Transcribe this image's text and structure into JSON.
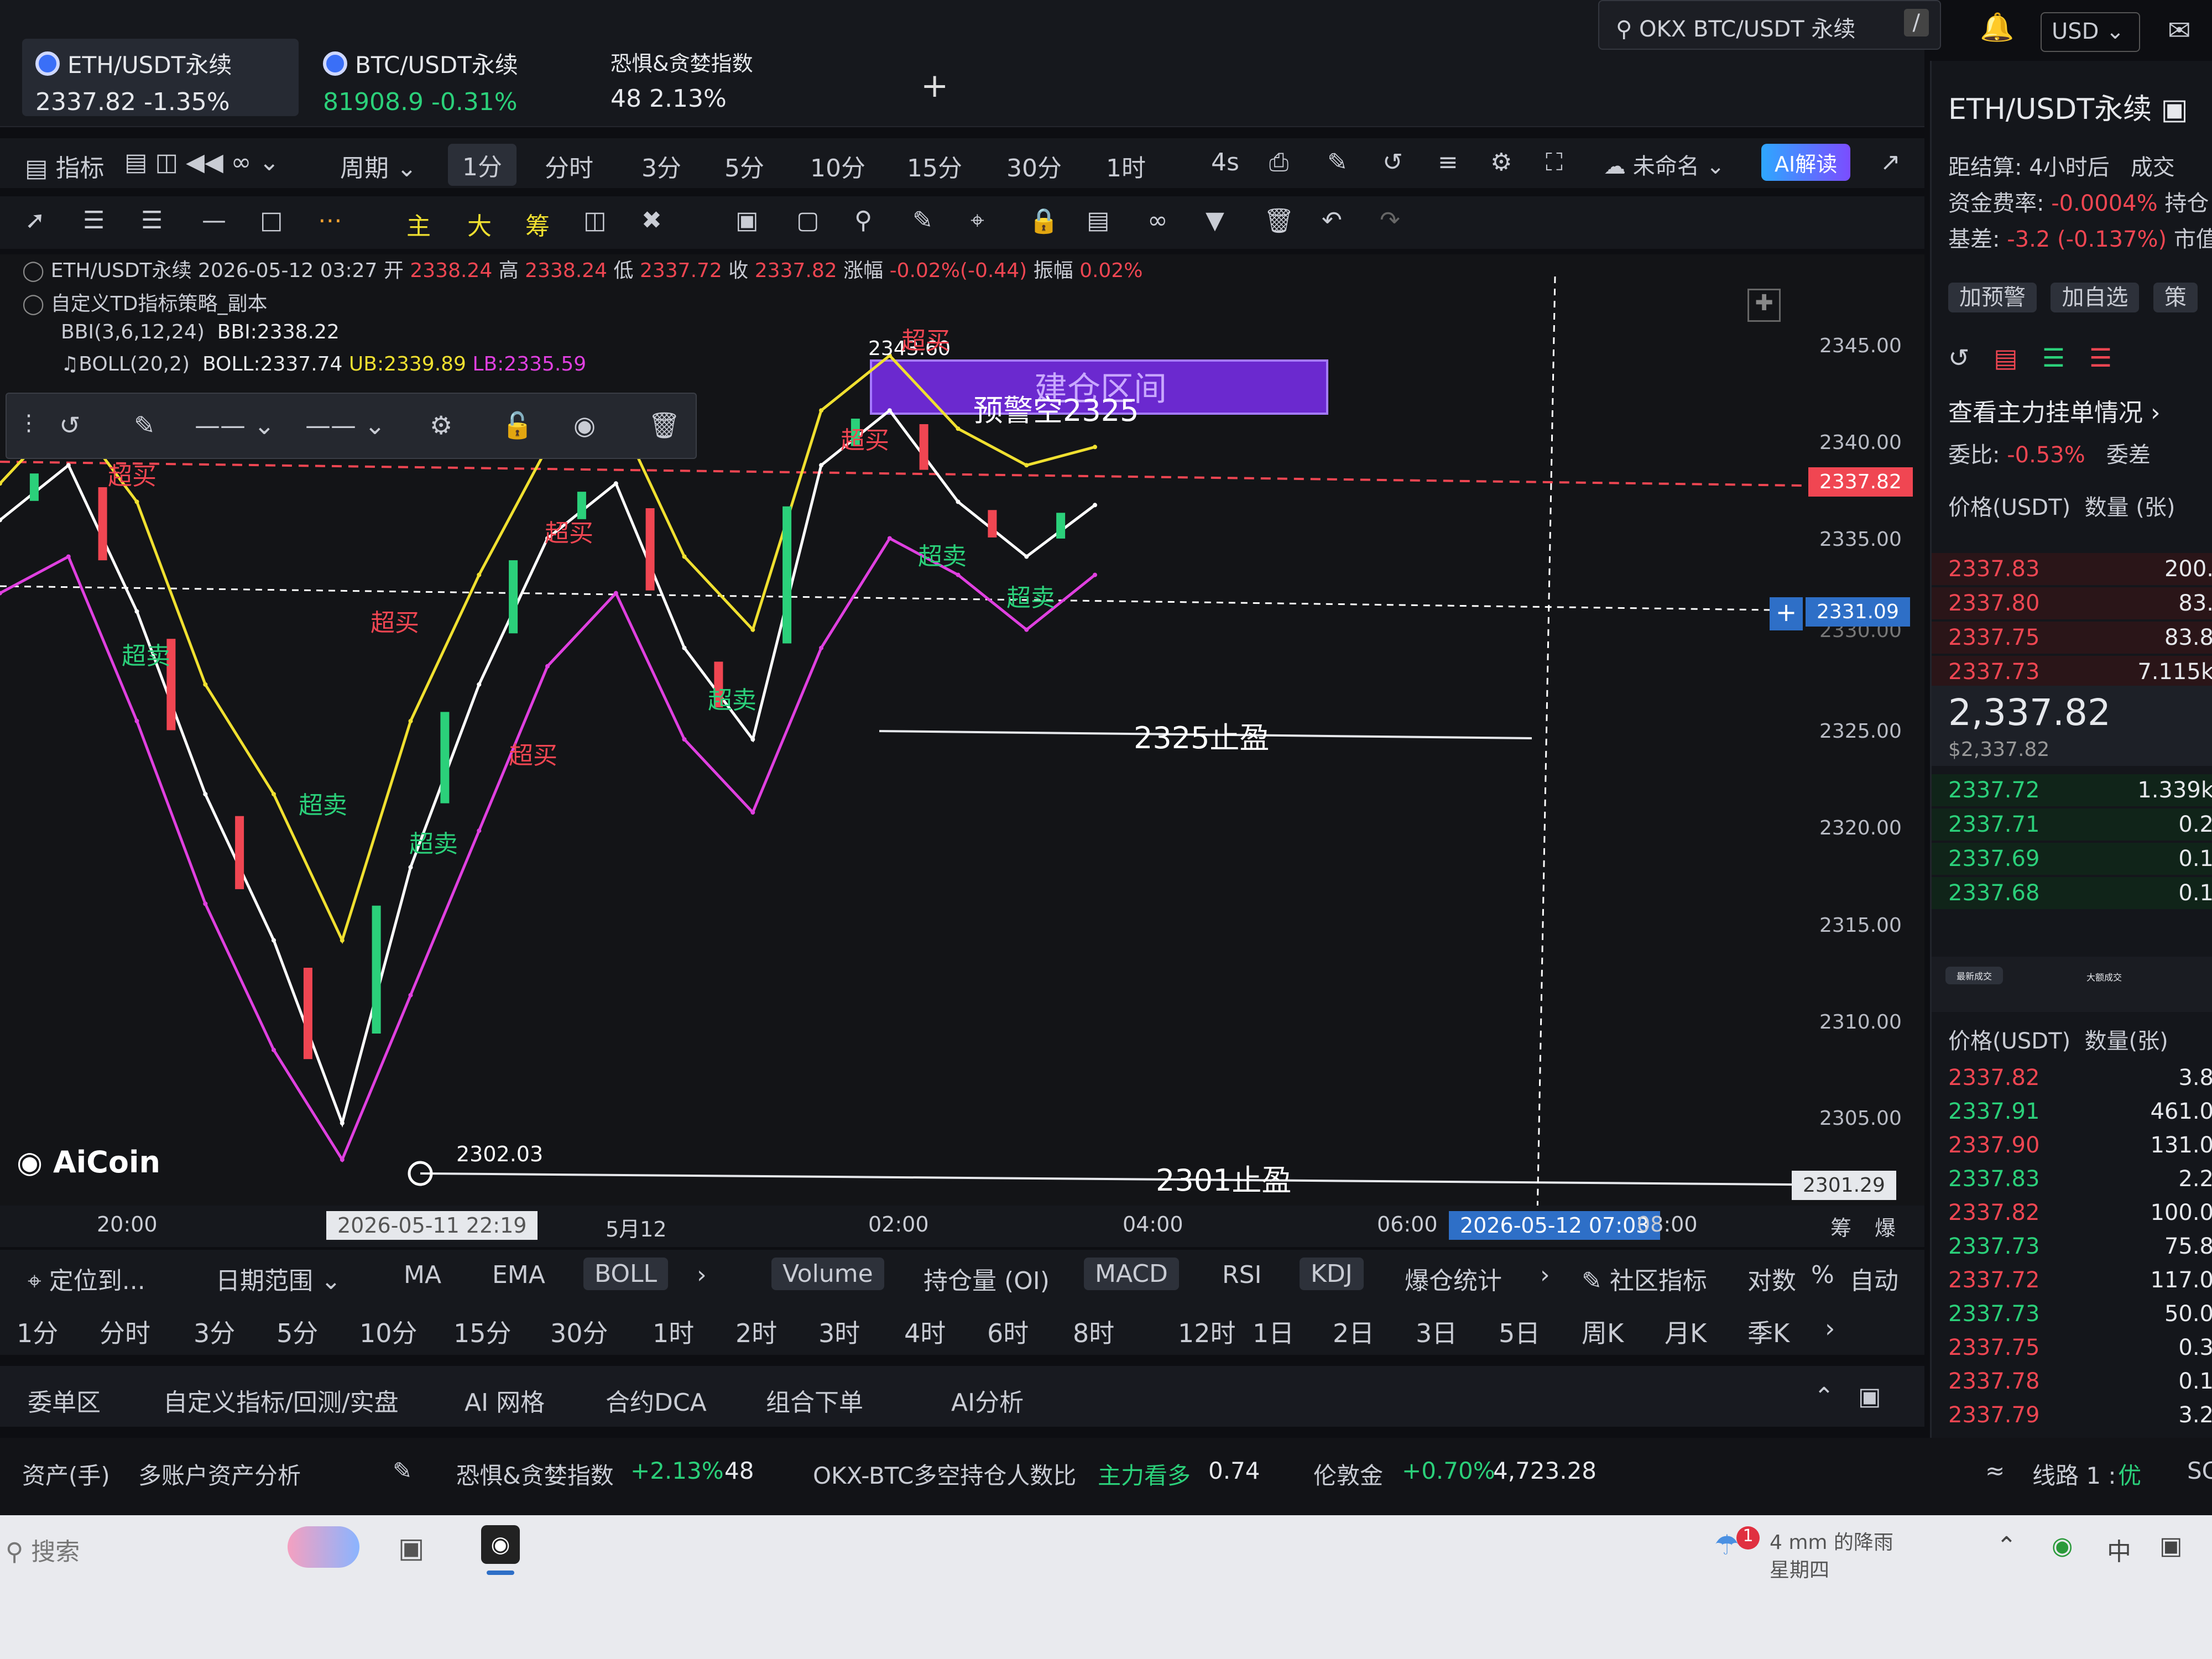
{
  "top_search": {
    "text": "OKX BTC/USDT 永续",
    "slash": "/",
    "currency": "USD"
  },
  "tabs": [
    {
      "name": "ETH/USDT永续",
      "price": "2337.82",
      "change": "-1.35%"
    },
    {
      "name": "BTC/USDT永续",
      "price": "81908.9",
      "change": "-0.31%"
    },
    {
      "name": "恐惧&贪婪指数",
      "price": "48",
      "change": "2.13%"
    }
  ],
  "add_tab": "+",
  "toolbar1": {
    "indicator": "指标",
    "period": "周期",
    "intervals": [
      "1分",
      "分时",
      "3分",
      "5分",
      "10分",
      "15分",
      "30分",
      "1时",
      "4s"
    ],
    "active_interval": "1分",
    "unnamed": "未命名",
    "ai": "AI解读"
  },
  "toolbar2": {
    "labels": [
      "主",
      "大",
      "筹"
    ]
  },
  "chart_info": {
    "symbol_line": "ETH/USDT永续 2026-05-12 03:27",
    "open_label": "开",
    "open": "2338.24",
    "high_label": "高",
    "high": "2338.24",
    "low_label": "低",
    "low": "2337.72",
    "close_label": "收",
    "close": "2337.82",
    "chg_label": "涨幅",
    "chg": "-0.02%(-0.44)",
    "amp_label": "振幅",
    "amp": "0.02%",
    "strategy": "自定义TD指标策略_副本",
    "bbi_name": "BBI(3,6,12,24)",
    "bbi": "BBI:2338.22",
    "boll_name": "BOLL(20,2)",
    "boll": "BOLL:2337.74",
    "ub": "UB:2339.89",
    "lb": "LB:2335.59"
  },
  "annotations": {
    "box_text": "建仓区间",
    "short_text": "预警空2325",
    "high_marker": "2343.60",
    "tp1": "2325止盈",
    "tp2": "2301止盈",
    "low_marker": "2302.03",
    "overbought": "超买",
    "oversold": "超卖"
  },
  "chart_data": {
    "type": "line",
    "title": "ETH/USDT永续",
    "x": [
      "20:00",
      "5月12",
      "02:00",
      "04:00",
      "06:00",
      "08:00"
    ],
    "yticks": [
      "2345.00",
      "2340.00",
      "2335.00",
      "2330.00",
      "2325.00",
      "2320.00",
      "2315.00",
      "2310.00",
      "2305.00"
    ],
    "ylim": [
      2301,
      2347
    ],
    "series": [
      {
        "values": [
          2337,
          2340,
          2332,
          2322,
          2314,
          2304,
          2318,
          2328,
          2336,
          2339,
          2330,
          2325,
          2340,
          2343,
          2338,
          2335,
          2337.82
        ],
        "color": "#ffffff"
      },
      {
        "values": [
          2339,
          2343,
          2338,
          2328,
          2322,
          2314,
          2326,
          2334,
          2341,
          2343,
          2335,
          2331,
          2343,
          2346,
          2342,
          2340,
          2341
        ],
        "color": "#f0e030"
      },
      {
        "values": [
          2333,
          2335,
          2326,
          2316,
          2308,
          2302,
          2311,
          2320,
          2329,
          2333,
          2325,
          2321,
          2330,
          2336,
          2334,
          2331,
          2334
        ],
        "color": "#e040e0"
      }
    ],
    "last_price": "2337.82",
    "cursor_price": "2331.09",
    "bottom_price": "2301.29",
    "cursor_time": "2026-05-12 07:03",
    "start_time": "2026-05-11 22:19"
  },
  "watermark": "AiCoin",
  "chart_bottom_right": [
    "筹",
    "爆"
  ],
  "bottom_toolbar": {
    "locate": "定位到...",
    "date_range": "日期范围",
    "indicators": [
      "MA",
      "EMA",
      "BOLL"
    ],
    "sub_indicators": [
      "Volume",
      "持仓量 (OI)",
      "MACD",
      "RSI",
      "KDJ",
      "爆仓统计"
    ],
    "community": "社区指标",
    "log": "对数",
    "pct": "%",
    "auto": "自动",
    "periods": [
      "1分",
      "分时",
      "3分",
      "5分",
      "10分",
      "15分",
      "30分",
      "1时",
      "2时",
      "3时",
      "4时",
      "6时",
      "8时",
      "12时",
      "1日",
      "2日",
      "3日",
      "5日",
      "周K",
      "月K",
      "季K"
    ],
    "panels": [
      "委单区",
      "自定义指标/回测/实盘",
      "AI 网格",
      "合约DCA",
      "组合下单",
      "AI分析"
    ]
  },
  "right": {
    "title": "ETH/USDT永续",
    "settle_label": "距结算:",
    "settle": "4小时后",
    "vol_label": "成交",
    "funding_label": "资金费率:",
    "funding": "-0.0004%",
    "hold_label": "持仓",
    "basis_label": "基差:",
    "basis": "-3.2 (-0.137%)",
    "market_label": "市值",
    "btns": [
      "加预警",
      "加自选",
      "策"
    ],
    "mainforce": "查看主力挂单情况",
    "ratio_label": "委比:",
    "ratio": "-0.53%",
    "diff_label": "委差",
    "hdr_price": "价格(USDT)",
    "hdr_qty": "数量 (张)",
    "asks": [
      [
        "2337.83",
        "200."
      ],
      [
        "2337.80",
        "83."
      ],
      [
        "2337.75",
        "83.8"
      ],
      [
        "2337.73",
        "7.115k"
      ]
    ],
    "mid_price": "2,337.82",
    "mid_usd": "$2,337.82",
    "bids": [
      [
        "2337.72",
        "1.339k"
      ],
      [
        "2337.71",
        "0.2"
      ],
      [
        "2337.69",
        "0.1"
      ],
      [
        "2337.68",
        "0.1"
      ]
    ],
    "trade_tabs": [
      "最新成交",
      "大额成交"
    ],
    "trade_hdr_price": "价格(USDT)",
    "trade_hdr_qty": "数量(张)",
    "trades": [
      [
        "2337.82",
        "3.8",
        "red"
      ],
      [
        "2337.91",
        "461.0",
        "green"
      ],
      [
        "2337.90",
        "131.0",
        "red"
      ],
      [
        "2337.83",
        "2.2",
        "green"
      ],
      [
        "2337.82",
        "100.0",
        "red"
      ],
      [
        "2337.73",
        "75.8",
        "green"
      ],
      [
        "2337.72",
        "117.0",
        "red"
      ],
      [
        "2337.73",
        "50.0",
        "green"
      ],
      [
        "2337.75",
        "0.3",
        "red"
      ],
      [
        "2337.78",
        "0.1",
        "red"
      ],
      [
        "2337.79",
        "3.2",
        "red"
      ]
    ]
  },
  "status": {
    "assets": "资产(手)",
    "multi": "多账户资产分析",
    "fear": "恐惧&贪婪指数",
    "fear_chg": "+2.13%",
    "fear_val": "48",
    "okx": "OKX-BTC多空持仓人数比",
    "okx_txt": "主力看多",
    "okx_val": "0.74",
    "gold": "伦敦金",
    "gold_chg": "+0.70%",
    "gold_val": "4,723.28",
    "route": "线路 1 :",
    "route_q": "优",
    "sc": "SC"
  },
  "taskbar": {
    "search": "搜索",
    "weather": "4 mm 的降雨",
    "weekday": "星期四",
    "ime": "中",
    "badge": "1"
  }
}
